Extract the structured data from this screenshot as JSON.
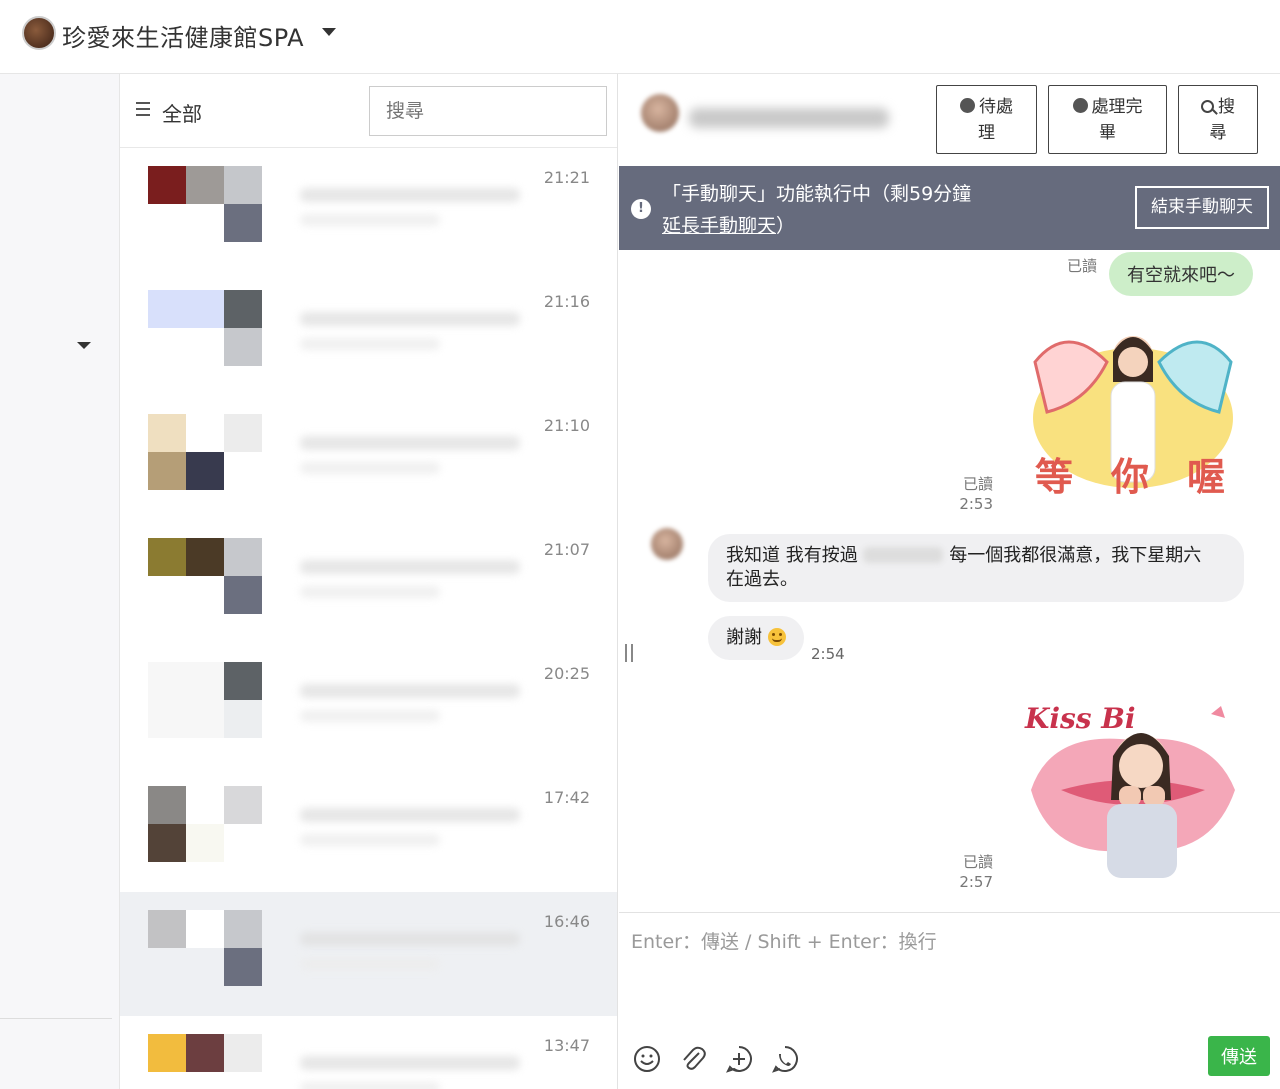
{
  "topbar": {
    "account_name": "珍愛來生活健康館SPA"
  },
  "list": {
    "filter_label": "全部",
    "search_placeholder": "搜尋",
    "conversations": [
      {
        "time": "21:21",
        "avatar_colors": [
          "#7a1e1e",
          "#9e9a97",
          "#c5c7cb",
          "#ffffff",
          "#ffffff",
          "#6b6f7f"
        ]
      },
      {
        "time": "21:16",
        "avatar_colors": [
          "#d8e0fb",
          "#d8e0fb",
          "#5d6266",
          "#ffffff",
          "#ffffff",
          "#c6c8cc"
        ]
      },
      {
        "time": "21:10",
        "avatar_colors": [
          "#efdfc0",
          "#ffffff",
          "#ececec",
          "#b59e77",
          "#383a4e",
          "#ffffff"
        ]
      },
      {
        "time": "21:07",
        "avatar_colors": [
          "#8b7b31",
          "#4b3a26",
          "#c6c8cc",
          "#ffffff",
          "#ffffff",
          "#6b6f7f"
        ]
      },
      {
        "time": "20:25",
        "avatar_colors": [
          "#f7f7f7",
          "#f7f7f7",
          "#5d6266",
          "#f7f7f7",
          "#f7f7f7",
          "#eceef0"
        ]
      },
      {
        "time": "17:42",
        "avatar_colors": [
          "#8a8886",
          "#ffffff",
          "#d8d8da",
          "#534338",
          "#f8f8f1",
          "#ffffff"
        ]
      },
      {
        "time": "16:46",
        "avatar_colors": [
          "#c2c2c4",
          "#ffffff",
          "#c6c8cc",
          "#eef0f3",
          "#eef0f3",
          "#6b6f7f"
        ]
      },
      {
        "time": "13:47",
        "avatar_colors": [
          "#f2bc3e",
          "#6c3e40",
          "#ececec",
          "#ffffff",
          "#ffffff",
          "#ffffff"
        ]
      }
    ]
  },
  "chat": {
    "header_buttons": {
      "pending": [
        "待處",
        "理"
      ],
      "done": [
        "處理完",
        "畢"
      ],
      "search": [
        "搜",
        "尋"
      ]
    },
    "banner": {
      "line1": "「手動聊天」功能執行中（剩59分鐘",
      "link": "延長手動聊天",
      "line2_suffix": "）",
      "end_button": "結束手動聊天"
    },
    "messages": {
      "read_label": "已讀",
      "out_text": "有空就來吧～",
      "sticker1_text": "等你喔",
      "sticker1_time": "2:53",
      "in_text_a": "我知道 我有按過",
      "in_text_b": "每一個我都很滿意，我下星期六",
      "in_text_c": "在過去。",
      "thanks_text": "謝謝",
      "thanks_time": "2:54",
      "sticker2_text": "Kiss Bi",
      "sticker2_time": "2:57"
    },
    "composer": {
      "placeholder": "Enter：傳送 / Shift + Enter：換行",
      "send_label": "傳送"
    },
    "colors": {
      "banner": "#666b7d",
      "out_bubble": "#cdeec9",
      "in_bubble": "#f0f0f2",
      "send": "#3ab54a"
    }
  }
}
